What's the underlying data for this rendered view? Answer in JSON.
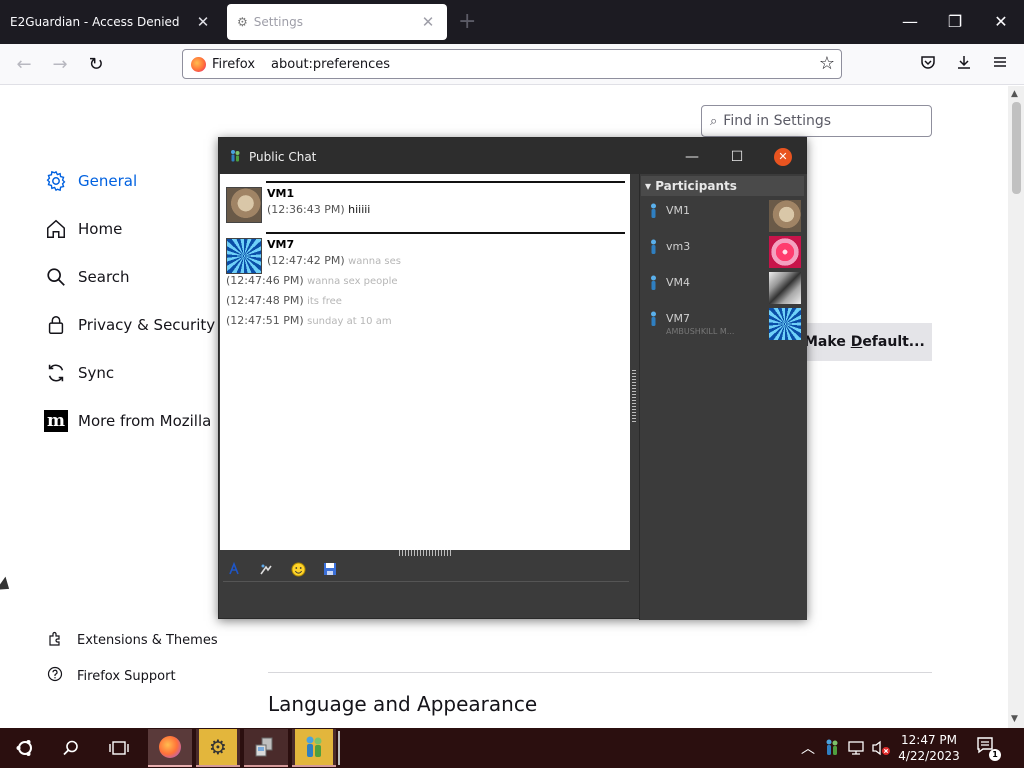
{
  "browser": {
    "tabs": [
      {
        "title": "E2Guardian - Access Denied",
        "close": "✕"
      },
      {
        "title": "Settings",
        "close": "✕"
      }
    ],
    "newtab": "+",
    "window_controls": {
      "minimize": "—",
      "maximize": "❐",
      "close": "✕"
    },
    "nav": {
      "back": "←",
      "forward": "→",
      "reload": "↻"
    },
    "urlbar": {
      "identity": "Firefox",
      "url": "about:preferences",
      "star": "☆"
    },
    "toolbar_icons": {
      "pocket": "pocket-icon",
      "downloads": "download-icon",
      "menu": "hamburger-menu-icon"
    }
  },
  "settings": {
    "find_placeholder": "Find in Settings",
    "categories": [
      {
        "label": "General",
        "icon": "gear-icon",
        "selected": true
      },
      {
        "label": "Home",
        "icon": "home-icon"
      },
      {
        "label": "Search",
        "icon": "search-icon"
      },
      {
        "label": "Privacy & Security",
        "icon": "lock-icon"
      },
      {
        "label": "Sync",
        "icon": "sync-icon"
      },
      {
        "label": "More from Mozilla",
        "icon": "mozilla-logo-icon"
      }
    ],
    "footer_links": [
      {
        "label": "Extensions & Themes",
        "icon": "puzzle-icon"
      },
      {
        "label": "Firefox Support",
        "icon": "help-icon"
      }
    ],
    "make_default_pre": "Make ",
    "make_default_accesskey": "D",
    "make_default_post": "efault...",
    "language_heading": "Language and Appearance"
  },
  "chat": {
    "title": "Public Chat",
    "controls": {
      "minimize": "—",
      "maximize": "☐",
      "close": "✕"
    },
    "messages": [
      {
        "sender": "VM1",
        "avatar": "cat-avatar",
        "lines": [
          {
            "time": "(12:36:43 PM)",
            "text": "hiiiii",
            "faint": false
          }
        ]
      },
      {
        "sender": "VM7",
        "avatar": "pinwheel-avatar",
        "lines": [
          {
            "time": "(12:47:42 PM)",
            "text": "wanna ses",
            "faint": true
          },
          {
            "time": "(12:47:46 PM)",
            "text": "wanna sex people",
            "faint": true
          },
          {
            "time": "(12:47:48 PM)",
            "text": "its free",
            "faint": true
          },
          {
            "time": "(12:47:51 PM)",
            "text": "sunday at 10 am",
            "faint": true
          }
        ]
      }
    ],
    "toolbar": [
      "font-icon",
      "attach-icon",
      "smiley-icon",
      "save-icon"
    ],
    "participants_header": "Participants",
    "participants": [
      {
        "name": "VM1",
        "status": "",
        "avatar": "cat-avatar"
      },
      {
        "name": "vm3",
        "status": "",
        "avatar": "star-avatar"
      },
      {
        "name": "VM4",
        "status": "",
        "avatar": "metal-avatar"
      },
      {
        "name": "VM7",
        "status": "AMBUSHKILL M...",
        "avatar": "pinwheel-avatar"
      }
    ]
  },
  "taskbar": {
    "apps": [
      "ubuntu-start-icon",
      "search-icon",
      "task-view-icon",
      "firefox-icon",
      "settings-app-icon",
      "network-app-icon",
      "chat-app-icon"
    ],
    "tray": [
      "chevron-up-icon",
      "chat-tray-icon",
      "network-icon",
      "muted-speaker-icon"
    ],
    "time": "12:47 PM",
    "date": "4/22/2023",
    "notifications": "1"
  },
  "colors": {
    "accent": "#0061e0",
    "chat_close": "#e95420",
    "taskbar": "#2b0f0f",
    "tab_strip": "#1c1b22"
  }
}
